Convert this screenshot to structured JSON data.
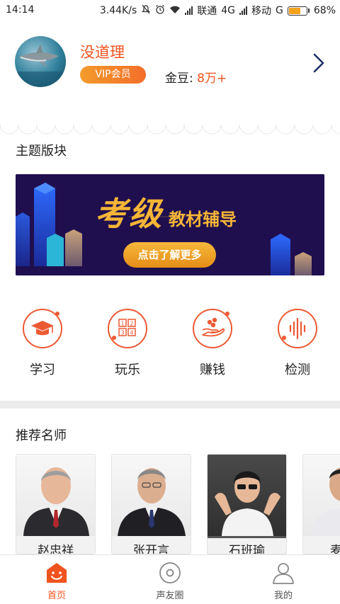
{
  "status_bar": {
    "time": "14:14",
    "speed": "3.44K/s",
    "carrier1": "联通",
    "net1": "4G",
    "carrier2": "移动",
    "net2": "G",
    "battery": "68%",
    "battery_level": 0.68
  },
  "profile": {
    "username": "没道理",
    "vip_label": "VIP会员",
    "coin_label": "金豆:",
    "coin_value": "8万+"
  },
  "theme_section": {
    "title": "主题版块",
    "banner": {
      "title": "考级",
      "subtitle": "教材辅导",
      "button": "点击了解更多"
    }
  },
  "categories": [
    {
      "label": "学习",
      "icon": "graduation-cap-icon"
    },
    {
      "label": "玩乐",
      "icon": "number-grid-icon"
    },
    {
      "label": "赚钱",
      "icon": "hand-coins-icon"
    },
    {
      "label": "检测",
      "icon": "sound-wave-icon"
    }
  ],
  "teachers_section": {
    "title": "推荐名师",
    "teachers": [
      {
        "name": "赵忠祥"
      },
      {
        "name": "张开言"
      },
      {
        "name": "石班瑜"
      },
      {
        "name": "麦"
      }
    ]
  },
  "tabbar": {
    "tabs": [
      {
        "label": "首页",
        "icon": "home-icon",
        "active": true
      },
      {
        "label": "声友圈",
        "icon": "disc-icon",
        "active": false
      },
      {
        "label": "我的",
        "icon": "user-icon",
        "active": false
      }
    ]
  },
  "colors": {
    "accent": "#f0531f",
    "vip_gradient_start": "#f39b2b",
    "banner_bg": "#1f0f4f",
    "banner_gold": "#f5b536"
  }
}
